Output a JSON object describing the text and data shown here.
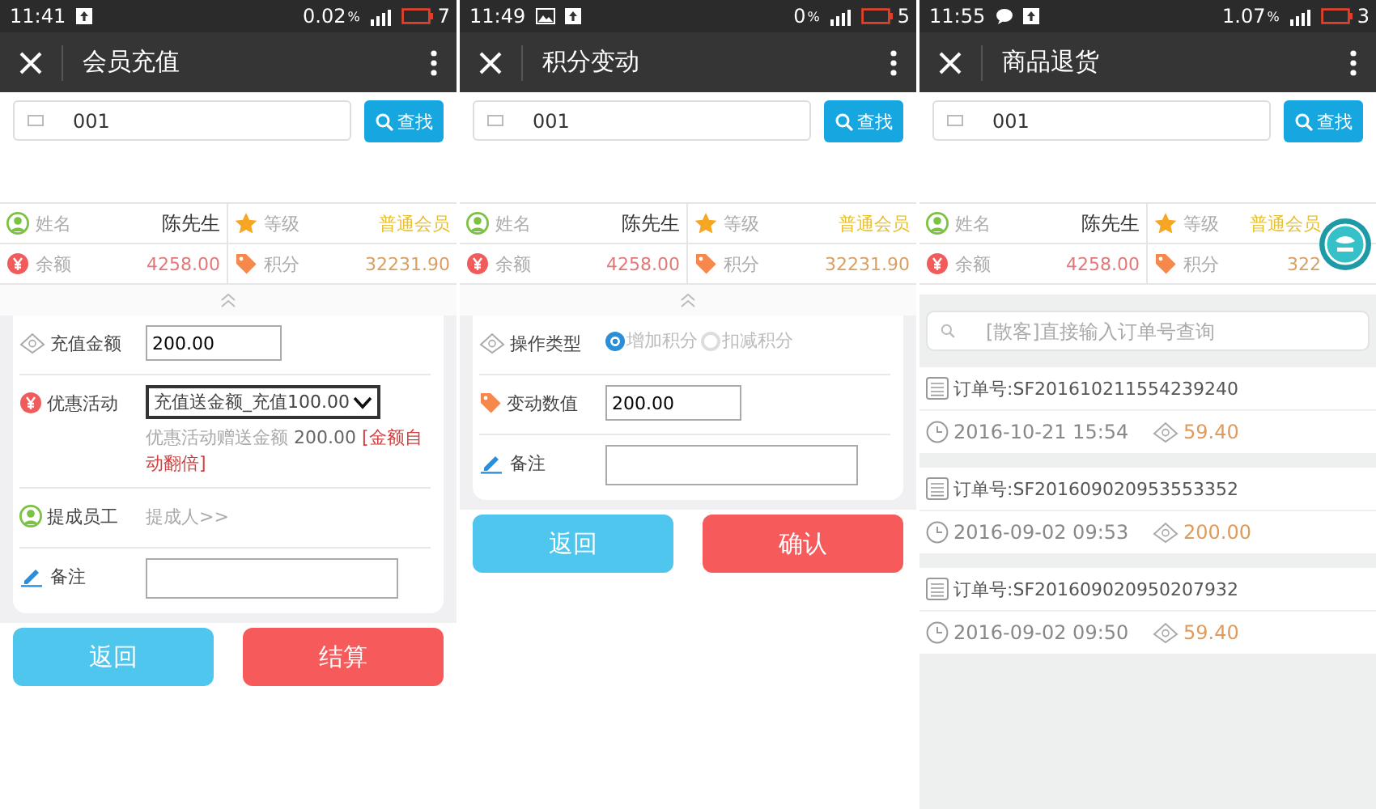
{
  "screens": [
    {
      "status": {
        "time": "11:41",
        "indicators": [
          {
            "kind": "upload"
          }
        ],
        "speed": "0.02",
        "unit": "%",
        "battery": "7"
      },
      "title": "会员充值",
      "search": {
        "value": "001",
        "button": "查找"
      },
      "member": [
        {
          "kind": "person",
          "label": "姓名",
          "value": "陈先生"
        },
        {
          "kind": "star",
          "label": "等级",
          "value": "普通会员"
        },
        {
          "kind": "yen",
          "label": "余额",
          "value": "4258.00"
        },
        {
          "kind": "tag",
          "label": "积分",
          "value": "32231.90"
        }
      ],
      "form": [
        {
          "kind": "amount",
          "label": "充值金额",
          "value": "200.00"
        },
        {
          "kind": "promo",
          "label": "优惠活动",
          "value": "充值送金额_充值100.00",
          "note": {
            "label": "优惠活动赠送金额",
            "value": "200.00",
            "extra": "[金额自动翻倍]"
          }
        },
        {
          "kind": "staff",
          "label": "提成员工",
          "value": "提成人>>"
        },
        {
          "kind": "remark",
          "label": "备注"
        }
      ],
      "buttons": [
        {
          "kind": "back",
          "label": "返回"
        },
        {
          "kind": "confirm",
          "label": "结算"
        }
      ]
    },
    {
      "status": {
        "time": "11:49",
        "indicators": [
          {
            "kind": "image"
          },
          {
            "kind": "upload"
          }
        ],
        "speed": "0",
        "unit": "%",
        "battery": "5"
      },
      "title": "积分变动",
      "search": {
        "value": "001",
        "button": "查找"
      },
      "member": [
        {
          "kind": "person",
          "label": "姓名",
          "value": "陈先生"
        },
        {
          "kind": "star",
          "label": "等级",
          "value": "普通会员"
        },
        {
          "kind": "yen",
          "label": "余额",
          "value": "4258.00"
        },
        {
          "kind": "tag",
          "label": "积分",
          "value": "32231.90"
        }
      ],
      "form": [
        {
          "kind": "operation",
          "label": "操作类型",
          "options": [
            {
              "label": "增加积分",
              "selected": true
            },
            {
              "label": "扣减积分",
              "selected": false
            }
          ]
        },
        {
          "kind": "change",
          "label": "变动数值",
          "value": "200.00"
        },
        {
          "kind": "remark",
          "label": "备注"
        }
      ],
      "buttons": [
        {
          "kind": "back",
          "label": "返回"
        },
        {
          "kind": "confirm",
          "label": "确认"
        }
      ]
    },
    {
      "status": {
        "time": "11:55",
        "indicators": [
          {
            "kind": "chat"
          },
          {
            "kind": "upload"
          }
        ],
        "speed": "1.07",
        "unit": "%",
        "battery": "3"
      },
      "title": "商品退货",
      "search": {
        "value": "001",
        "button": "查找"
      },
      "member": [
        {
          "kind": "person",
          "label": "姓名",
          "value": "陈先生"
        },
        {
          "kind": "star",
          "label": "等级",
          "value": "普通会员"
        },
        {
          "kind": "yen",
          "label": "余额",
          "value": "4258.00"
        },
        {
          "kind": "tag",
          "label": "积分",
          "value": "322"
        }
      ],
      "floating_button": true,
      "order_search": {
        "placeholder": "[散客]直接输入订单号查询"
      },
      "orders": [
        {
          "number": "订单号:SF201610211554239240",
          "time": "2016-10-21 15:54",
          "amount": "59.40"
        },
        {
          "number": "订单号:SF201609020953553352",
          "time": "2016-09-02 09:53",
          "amount": "200.00"
        },
        {
          "number": "订单号:SF201609020950207932",
          "time": "2016-09-02 09:50",
          "amount": "59.40"
        }
      ]
    }
  ]
}
